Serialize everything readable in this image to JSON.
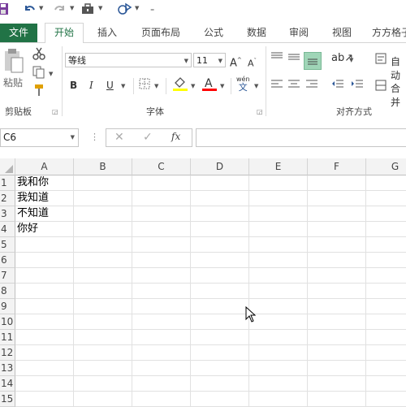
{
  "ribbon_tabs": [
    "文件",
    "开始",
    "插入",
    "页面布局",
    "公式",
    "数据",
    "审阅",
    "视图",
    "方方格子"
  ],
  "clipboard": {
    "paste_label": "粘贴",
    "group_label": "剪贴板"
  },
  "font": {
    "name": "等线",
    "size": "11",
    "group_label": "字体",
    "wen_label": "wén",
    "wen_char": "文"
  },
  "alignment": {
    "group_label": "对齐方式",
    "wrap_label": "自动",
    "merge_label": "合并"
  },
  "formula_bar": {
    "name_box": "C6",
    "fx_label": "fx",
    "formula": ""
  },
  "columns": [
    "A",
    "B",
    "C",
    "D",
    "E",
    "F",
    "G"
  ],
  "rows": [
    "1",
    "2",
    "3",
    "4",
    "5",
    "6",
    "7",
    "8",
    "9",
    "10",
    "11",
    "12",
    "13",
    "14",
    "15"
  ],
  "cells": {
    "A1": "我和你",
    "A2": "我知道",
    "A3": "不知道",
    "A4": "你好"
  },
  "colors": {
    "accent": "#217346",
    "highlight": "#ffff00",
    "font_color": "#ff0000",
    "align_active": "#9fd5b7"
  }
}
